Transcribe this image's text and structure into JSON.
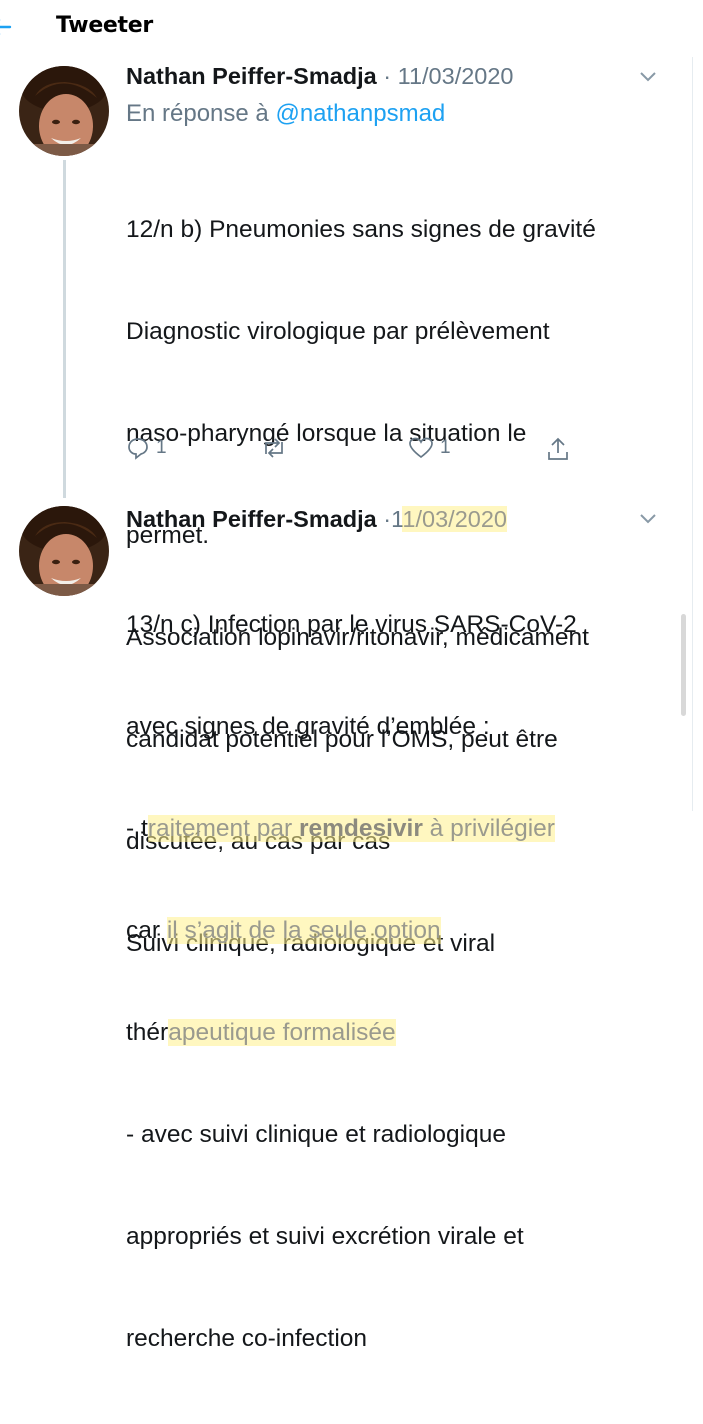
{
  "header": {
    "title": "Tweeter"
  },
  "tweets": [
    {
      "author": "Nathan Peiffer-Smadja",
      "separator": "·",
      "date": "11/03/2020",
      "reply_prefix": "En réponse à",
      "reply_handle": "@nathanpsmad",
      "lines": [
        "12/n b) Pneumonies sans signes de gravité",
        "Diagnostic virologique par prélèvement",
        "naso-pharyngé lorsque la situation le",
        "permet.",
        "Association lopinavir/ritonavir, médicament",
        "candidat potentiel pour l’OMS, peut être",
        "discutée, au cas par cas",
        "Suivi clinique, radiologique et viral"
      ],
      "reply_count": "1",
      "like_count": "1"
    },
    {
      "author": "Nathan Peiffer-Smadja",
      "separator": "·",
      "date_part1": "1",
      "date_part2": "1/03/2020",
      "line1": "13/n c) Infection par le virus SARS-CoV-2",
      "line2": "avec signes de gravité d’emblée :",
      "line3_a": "- t",
      "line3_b": "raitement par ",
      "line3_c": "remdesivir",
      "line3_d": " à privilégier",
      "line4_a": "car ",
      "line4_b": "il s’agit de la seule option",
      "line5_a": "thér",
      "line5_b": "apeutique formalisée",
      "line6": "- avec suivi clinique et radiologique",
      "line7": "appropriés et suivi excrétion virale et",
      "line8": "recherche co-infection"
    }
  ],
  "icons": {
    "back": "arrow-left-icon",
    "chevron": "chevron-down-icon",
    "reply": "reply-icon",
    "retweet": "retweet-icon",
    "like": "heart-icon",
    "share": "share-icon"
  },
  "colors": {
    "accent": "#1da1f2",
    "muted": "#657786",
    "highlight": "#fff08c"
  }
}
